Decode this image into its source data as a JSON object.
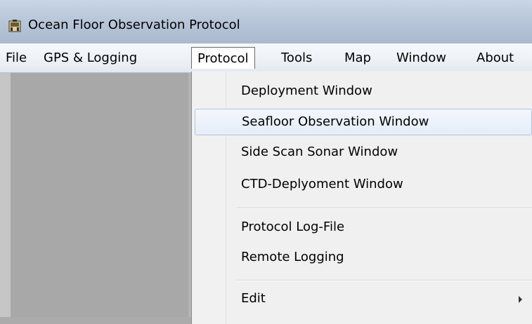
{
  "window": {
    "title": "Ocean Floor Observation Protocol",
    "icon": "app-icon"
  },
  "menubar": {
    "items": [
      {
        "label": "File"
      },
      {
        "label": "GPS & Logging"
      },
      {
        "label": "Protocol",
        "active": true
      },
      {
        "label": "Tools"
      },
      {
        "label": "Map"
      },
      {
        "label": "Window"
      },
      {
        "label": "About"
      }
    ]
  },
  "dropdown": {
    "items": [
      {
        "label": "Deployment Window"
      },
      {
        "label": "Seafloor Observation Window",
        "highlighted": true
      },
      {
        "label": "Side Scan Sonar Window"
      },
      {
        "label": "CTD-Deplyoment Window"
      },
      {
        "label": "Protocol Log-File"
      },
      {
        "label": "Remote Logging"
      },
      {
        "label": "Edit",
        "submenu": true
      }
    ]
  },
  "colors": {
    "titlebar": "#b9c7da",
    "menubar": "#eef2f7",
    "panel": "#a8a8a8",
    "dropdown": "#f0f0f0",
    "highlight_border": "#aec5e2"
  }
}
